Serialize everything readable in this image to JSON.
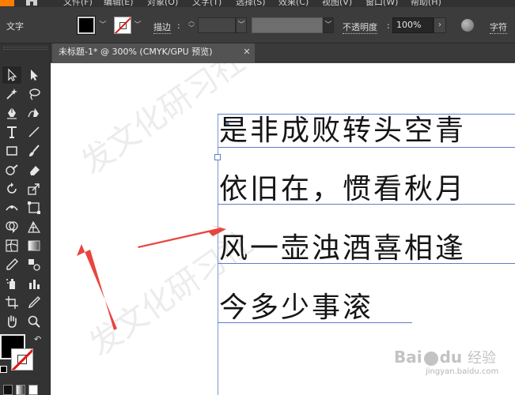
{
  "menubar": {
    "items": [
      "文件(F)",
      "编辑(E)",
      "对象(O)",
      "文字(T)",
      "选择(S)",
      "效果(C)",
      "视图(V)",
      "窗口(W)",
      "帮助(H)"
    ]
  },
  "controlbar": {
    "context_label": "文字",
    "stroke_label": "描边",
    "opacity_label": "不透明度",
    "opacity_value": "100%",
    "character_label": "字符",
    "colors": {
      "fill": "#000000",
      "stroke_none_slash": "#e01515"
    }
  },
  "document": {
    "tab_title": "未标题-1* @ 300% (CMYK/GPU 预览)",
    "close_glyph": "✕"
  },
  "text_lines": [
    "是非成败转头空青",
    "依旧在，惯看秋月",
    "风一壶浊酒喜相逢",
    "今多少事滚"
  ],
  "watermark": {
    "text": "发文化研习社",
    "baidu": "Bai",
    "baidu_du": "du",
    "baidu_jingyan": "经验",
    "url": "jingyan.baidu.com"
  },
  "toolbar": {
    "tools": [
      "selection-tool",
      "direct-selection-tool",
      "magic-wand-tool",
      "lasso-tool",
      "pen-tool",
      "curvature-tool",
      "type-tool",
      "line-tool",
      "rectangle-tool",
      "paintbrush-tool",
      "shaper-tool",
      "eraser-tool",
      "rotate-tool",
      "scale-tool",
      "width-tool",
      "free-transform-tool",
      "shape-builder-tool",
      "perspective-grid-tool",
      "mesh-tool",
      "gradient-tool",
      "eyedropper-tool",
      "blend-tool",
      "symbol-sprayer-tool",
      "column-graph-tool",
      "artboard-tool",
      "slice-tool",
      "hand-tool",
      "zoom-tool"
    ],
    "swap_glyph": "↶"
  },
  "annotations": {
    "arrow_color": "#e8453c"
  }
}
